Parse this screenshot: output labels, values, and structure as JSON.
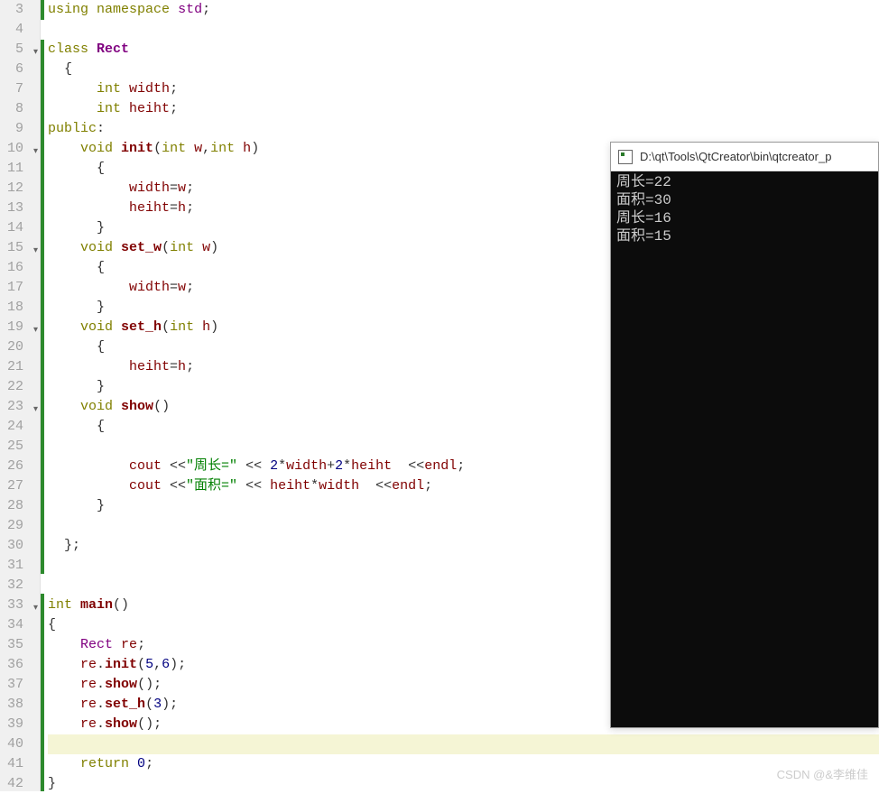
{
  "lines": [
    {
      "n": 3,
      "fold": false,
      "bar": true,
      "tokens": [
        [
          "kw",
          "using"
        ],
        [
          "punc",
          " "
        ],
        [
          "kw",
          "namespace"
        ],
        [
          "punc",
          " "
        ],
        [
          "cls",
          "std"
        ],
        [
          "punc",
          ";"
        ]
      ]
    },
    {
      "n": 4,
      "fold": false,
      "bar": false,
      "tokens": []
    },
    {
      "n": 5,
      "fold": true,
      "bar": true,
      "tokens": [
        [
          "kw",
          "class"
        ],
        [
          "punc",
          " "
        ],
        [
          "cls-bold",
          "Rect"
        ]
      ]
    },
    {
      "n": 6,
      "fold": false,
      "bar": true,
      "tokens": [
        [
          "punc",
          "  {"
        ]
      ]
    },
    {
      "n": 7,
      "fold": false,
      "bar": true,
      "tokens": [
        [
          "punc",
          "      "
        ],
        [
          "kw",
          "int"
        ],
        [
          "punc",
          " "
        ],
        [
          "var",
          "width"
        ],
        [
          "punc",
          ";"
        ]
      ]
    },
    {
      "n": 8,
      "fold": false,
      "bar": true,
      "tokens": [
        [
          "punc",
          "      "
        ],
        [
          "kw",
          "int"
        ],
        [
          "punc",
          " "
        ],
        [
          "var",
          "heiht"
        ],
        [
          "punc",
          ";"
        ]
      ]
    },
    {
      "n": 9,
      "fold": false,
      "bar": true,
      "tokens": [
        [
          "kw",
          "public"
        ],
        [
          "punc",
          ":"
        ]
      ]
    },
    {
      "n": 10,
      "fold": true,
      "bar": true,
      "tokens": [
        [
          "punc",
          "    "
        ],
        [
          "kw",
          "void"
        ],
        [
          "punc",
          " "
        ],
        [
          "fn-bold",
          "init"
        ],
        [
          "punc",
          "("
        ],
        [
          "kw",
          "int"
        ],
        [
          "punc",
          " "
        ],
        [
          "var",
          "w"
        ],
        [
          "punc",
          ","
        ],
        [
          "kw",
          "int"
        ],
        [
          "punc",
          " "
        ],
        [
          "var",
          "h"
        ],
        [
          "punc",
          ")"
        ]
      ]
    },
    {
      "n": 11,
      "fold": false,
      "bar": true,
      "tokens": [
        [
          "punc",
          "      {"
        ]
      ]
    },
    {
      "n": 12,
      "fold": false,
      "bar": true,
      "tokens": [
        [
          "punc",
          "          "
        ],
        [
          "var",
          "width"
        ],
        [
          "punc",
          "="
        ],
        [
          "var",
          "w"
        ],
        [
          "punc",
          ";"
        ]
      ]
    },
    {
      "n": 13,
      "fold": false,
      "bar": true,
      "tokens": [
        [
          "punc",
          "          "
        ],
        [
          "var",
          "heiht"
        ],
        [
          "punc",
          "="
        ],
        [
          "var",
          "h"
        ],
        [
          "punc",
          ";"
        ]
      ]
    },
    {
      "n": 14,
      "fold": false,
      "bar": true,
      "tokens": [
        [
          "punc",
          "      }"
        ]
      ]
    },
    {
      "n": 15,
      "fold": true,
      "bar": true,
      "tokens": [
        [
          "punc",
          "    "
        ],
        [
          "kw",
          "void"
        ],
        [
          "punc",
          " "
        ],
        [
          "fn-bold",
          "set_w"
        ],
        [
          "punc",
          "("
        ],
        [
          "kw",
          "int"
        ],
        [
          "punc",
          " "
        ],
        [
          "var",
          "w"
        ],
        [
          "punc",
          ")"
        ]
      ]
    },
    {
      "n": 16,
      "fold": false,
      "bar": true,
      "tokens": [
        [
          "punc",
          "      {"
        ]
      ]
    },
    {
      "n": 17,
      "fold": false,
      "bar": true,
      "tokens": [
        [
          "punc",
          "          "
        ],
        [
          "var",
          "width"
        ],
        [
          "punc",
          "="
        ],
        [
          "var",
          "w"
        ],
        [
          "punc",
          ";"
        ]
      ]
    },
    {
      "n": 18,
      "fold": false,
      "bar": true,
      "tokens": [
        [
          "punc",
          "      }"
        ]
      ]
    },
    {
      "n": 19,
      "fold": true,
      "bar": true,
      "tokens": [
        [
          "punc",
          "    "
        ],
        [
          "kw",
          "void"
        ],
        [
          "punc",
          " "
        ],
        [
          "fn-bold",
          "set_h"
        ],
        [
          "punc",
          "("
        ],
        [
          "kw",
          "int"
        ],
        [
          "punc",
          " "
        ],
        [
          "var",
          "h"
        ],
        [
          "punc",
          ")"
        ]
      ]
    },
    {
      "n": 20,
      "fold": false,
      "bar": true,
      "tokens": [
        [
          "punc",
          "      {"
        ]
      ]
    },
    {
      "n": 21,
      "fold": false,
      "bar": true,
      "tokens": [
        [
          "punc",
          "          "
        ],
        [
          "var",
          "heiht"
        ],
        [
          "punc",
          "="
        ],
        [
          "var",
          "h"
        ],
        [
          "punc",
          ";"
        ]
      ]
    },
    {
      "n": 22,
      "fold": false,
      "bar": true,
      "tokens": [
        [
          "punc",
          "      }"
        ]
      ]
    },
    {
      "n": 23,
      "fold": true,
      "bar": true,
      "tokens": [
        [
          "punc",
          "    "
        ],
        [
          "kw",
          "void"
        ],
        [
          "punc",
          " "
        ],
        [
          "fn-bold",
          "show"
        ],
        [
          "punc",
          "()"
        ]
      ]
    },
    {
      "n": 24,
      "fold": false,
      "bar": true,
      "tokens": [
        [
          "punc",
          "      {"
        ]
      ]
    },
    {
      "n": 25,
      "fold": false,
      "bar": true,
      "tokens": []
    },
    {
      "n": 26,
      "fold": false,
      "bar": true,
      "tokens": [
        [
          "punc",
          "          "
        ],
        [
          "var",
          "cout"
        ],
        [
          "punc",
          " <<"
        ],
        [
          "str",
          "\"周长=\""
        ],
        [
          "punc",
          " << "
        ],
        [
          "num",
          "2"
        ],
        [
          "punc",
          "*"
        ],
        [
          "var",
          "width"
        ],
        [
          "punc",
          "+"
        ],
        [
          "num",
          "2"
        ],
        [
          "punc",
          "*"
        ],
        [
          "var",
          "heiht"
        ],
        [
          "punc",
          "  <<"
        ],
        [
          "var",
          "endl"
        ],
        [
          "punc",
          ";"
        ]
      ]
    },
    {
      "n": 27,
      "fold": false,
      "bar": true,
      "tokens": [
        [
          "punc",
          "          "
        ],
        [
          "var",
          "cout"
        ],
        [
          "punc",
          " <<"
        ],
        [
          "str",
          "\"面积=\""
        ],
        [
          "punc",
          " << "
        ],
        [
          "var",
          "heiht"
        ],
        [
          "punc",
          "*"
        ],
        [
          "var",
          "width"
        ],
        [
          "punc",
          "  <<"
        ],
        [
          "var",
          "endl"
        ],
        [
          "punc",
          ";"
        ]
      ]
    },
    {
      "n": 28,
      "fold": false,
      "bar": true,
      "tokens": [
        [
          "punc",
          "      }"
        ]
      ]
    },
    {
      "n": 29,
      "fold": false,
      "bar": true,
      "tokens": []
    },
    {
      "n": 30,
      "fold": false,
      "bar": true,
      "tokens": [
        [
          "punc",
          "  };"
        ]
      ]
    },
    {
      "n": 31,
      "fold": false,
      "bar": true,
      "tokens": []
    },
    {
      "n": 32,
      "fold": false,
      "bar": false,
      "tokens": []
    },
    {
      "n": 33,
      "fold": true,
      "bar": true,
      "tokens": [
        [
          "kw",
          "int"
        ],
        [
          "punc",
          " "
        ],
        [
          "fn-bold",
          "main"
        ],
        [
          "punc",
          "()"
        ]
      ]
    },
    {
      "n": 34,
      "fold": false,
      "bar": true,
      "tokens": [
        [
          "punc",
          "{"
        ]
      ]
    },
    {
      "n": 35,
      "fold": false,
      "bar": true,
      "tokens": [
        [
          "punc",
          "    "
        ],
        [
          "cls",
          "Rect"
        ],
        [
          "punc",
          " "
        ],
        [
          "var",
          "re"
        ],
        [
          "punc",
          ";"
        ]
      ]
    },
    {
      "n": 36,
      "fold": false,
      "bar": true,
      "tokens": [
        [
          "punc",
          "    "
        ],
        [
          "var",
          "re"
        ],
        [
          "punc",
          "."
        ],
        [
          "fn",
          "init"
        ],
        [
          "punc",
          "("
        ],
        [
          "num",
          "5"
        ],
        [
          "punc",
          ","
        ],
        [
          "num",
          "6"
        ],
        [
          "punc",
          ");"
        ]
      ]
    },
    {
      "n": 37,
      "fold": false,
      "bar": true,
      "tokens": [
        [
          "punc",
          "    "
        ],
        [
          "var",
          "re"
        ],
        [
          "punc",
          "."
        ],
        [
          "fn",
          "show"
        ],
        [
          "punc",
          "();"
        ]
      ]
    },
    {
      "n": 38,
      "fold": false,
      "bar": true,
      "tokens": [
        [
          "punc",
          "    "
        ],
        [
          "var",
          "re"
        ],
        [
          "punc",
          "."
        ],
        [
          "fn",
          "set_h"
        ],
        [
          "punc",
          "("
        ],
        [
          "num",
          "3"
        ],
        [
          "punc",
          ");"
        ]
      ]
    },
    {
      "n": 39,
      "fold": false,
      "bar": true,
      "tokens": [
        [
          "punc",
          "    "
        ],
        [
          "var",
          "re"
        ],
        [
          "punc",
          "."
        ],
        [
          "fn",
          "show"
        ],
        [
          "punc",
          "();"
        ]
      ]
    },
    {
      "n": 40,
      "fold": false,
      "bar": true,
      "hl": true,
      "tokens": []
    },
    {
      "n": 41,
      "fold": false,
      "bar": true,
      "tokens": [
        [
          "punc",
          "    "
        ],
        [
          "kw",
          "return"
        ],
        [
          "punc",
          " "
        ],
        [
          "num",
          "0"
        ],
        [
          "punc",
          ";"
        ]
      ]
    },
    {
      "n": 42,
      "fold": false,
      "bar": true,
      "tokens": [
        [
          "punc",
          "}"
        ]
      ]
    }
  ],
  "console": {
    "title": "D:\\qt\\Tools\\QtCreator\\bin\\qtcreator_p",
    "output": [
      "周长=22",
      "面积=30",
      "周长=16",
      "面积=15"
    ]
  },
  "watermark": "CSDN @&李维佳"
}
